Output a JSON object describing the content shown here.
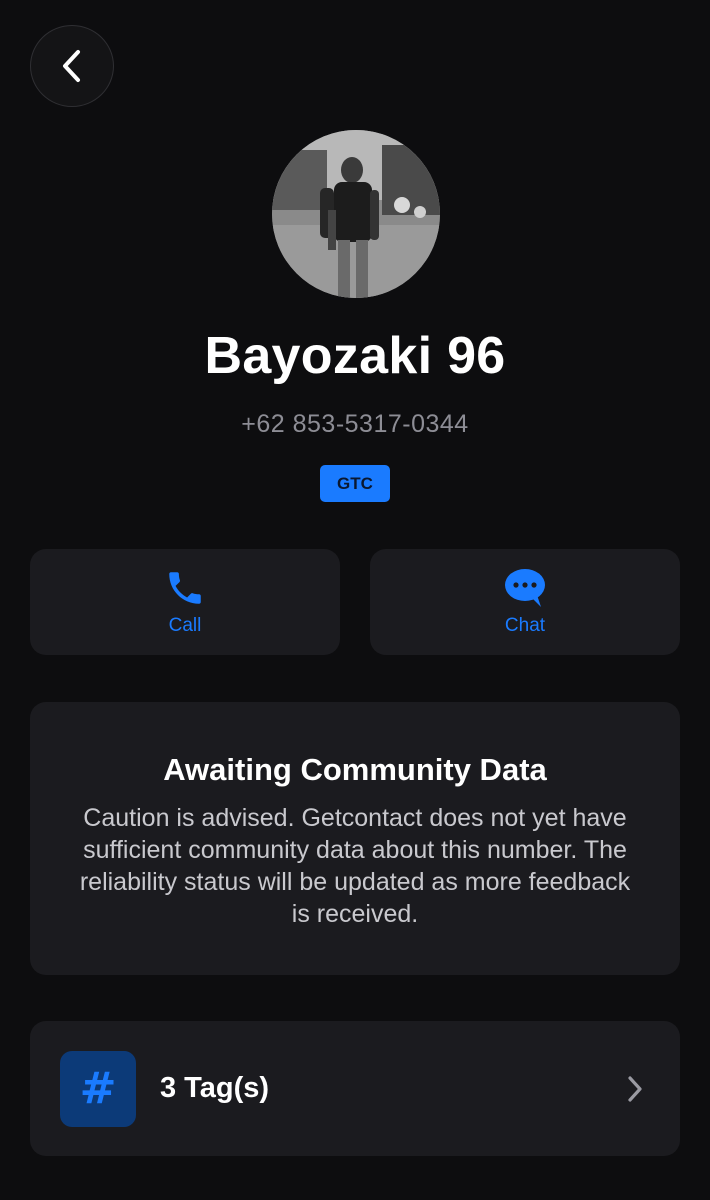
{
  "header": {
    "back_icon": "chevron-left-icon"
  },
  "profile": {
    "name": "Bayozaki 96",
    "phone": "+62 853-5317-0344",
    "badge": "GTC",
    "avatar_icon": "profile-photo"
  },
  "actions": {
    "call": {
      "label": "Call",
      "icon": "phone-icon"
    },
    "chat": {
      "label": "Chat",
      "icon": "chat-bubble-icon"
    }
  },
  "info": {
    "title": "Awaiting Community Data",
    "body": "Caution is advised. Getcontact does not yet have sufficient community data about this number. The reliability status will be updated as more feedback is received."
  },
  "tags": {
    "label": "3 Tag(s)",
    "icon": "hash-icon",
    "chevron": "chevron-right-icon"
  },
  "colors": {
    "background": "#0d0d0f",
    "card": "#1b1b1f",
    "accent": "#1a7bff",
    "muted_text": "#8d8d95"
  }
}
